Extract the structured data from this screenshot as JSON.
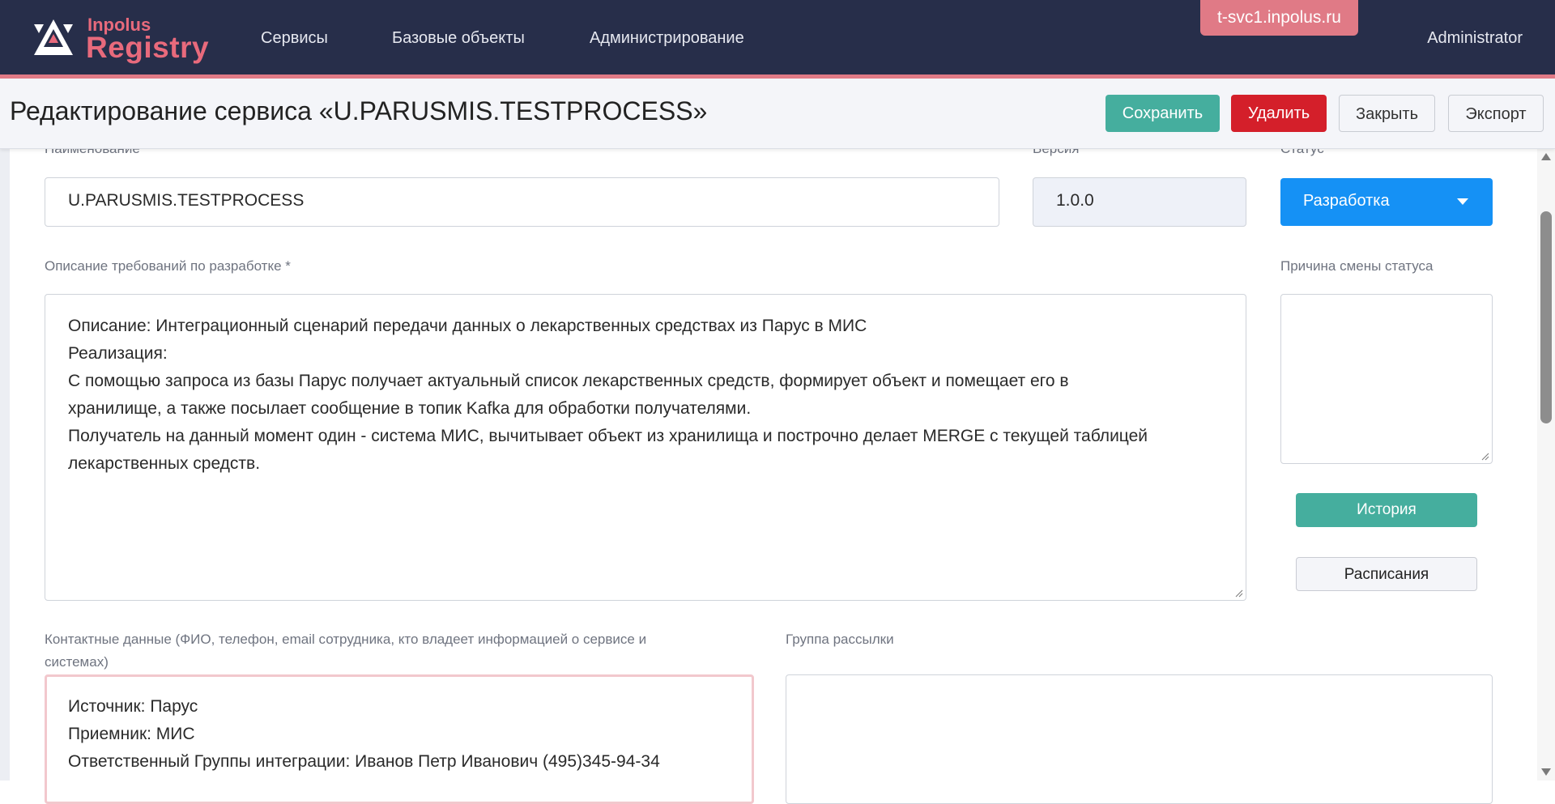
{
  "navbar": {
    "logo_top": "Inpolus",
    "logo_main": "Registry",
    "items": [
      {
        "label": "Сервисы"
      },
      {
        "label": "Базовые объекты"
      },
      {
        "label": "Администрирование"
      }
    ],
    "environment": "t-svc1.inpolus.ru",
    "user": "Administrator"
  },
  "header": {
    "title": "Редактирование сервиса «U.PARUSMIS.TESTPROCESS»",
    "save_label": "Сохранить",
    "delete_label": "Удалить",
    "close_label": "Закрыть",
    "export_label": "Экспорт"
  },
  "form": {
    "name_label": "Наименование *",
    "name_value": "U.PARUSMIS.TESTPROCESS",
    "version_label": "Версия *",
    "version_value": "1.0.0",
    "status_label": "Статус",
    "status_value": "Разработка",
    "description_label": "Описание требований по разработке *",
    "description_lines": [
      "Описание: Интеграционный сценарий передачи данных о лекарственных средствах из Парус в МИС",
      "Реализация:",
      "С помощью запроса из базы Парус получает актуальный список лекарственных средств, формирует объект и помещает его в",
      "хранилище, а также посылает сообщение в топик Kafka для обработки получателями.",
      "Получатель на данный момент один - система МИС, вычитывает объект из хранилища и построчно делает MERGE с текущей таблицей",
      "лекарственных средств."
    ],
    "reason_label": "Причина смены статуса",
    "reason_value": "",
    "history_label": "История",
    "schedule_label": "Расписания",
    "contacts_label_line1": "Контактные данные (ФИО, телефон, email сотрудника, кто владеет информацией о сервисе и",
    "contacts_label_line2": "системах)",
    "contacts_lines": [
      "Источник: Парус",
      "Приемник: МИС",
      "Ответственный Группы интеграции: Иванов Петр Иванович (495)345-94-34"
    ],
    "mailing_label": "Группа рассылки",
    "mailing_value": ""
  },
  "colors": {
    "navbar_bg": "#272e4a",
    "accent_pink": "#e07a86",
    "save_green": "#45ae9e",
    "delete_red": "#d41f2a",
    "status_blue": "#1591f5"
  }
}
